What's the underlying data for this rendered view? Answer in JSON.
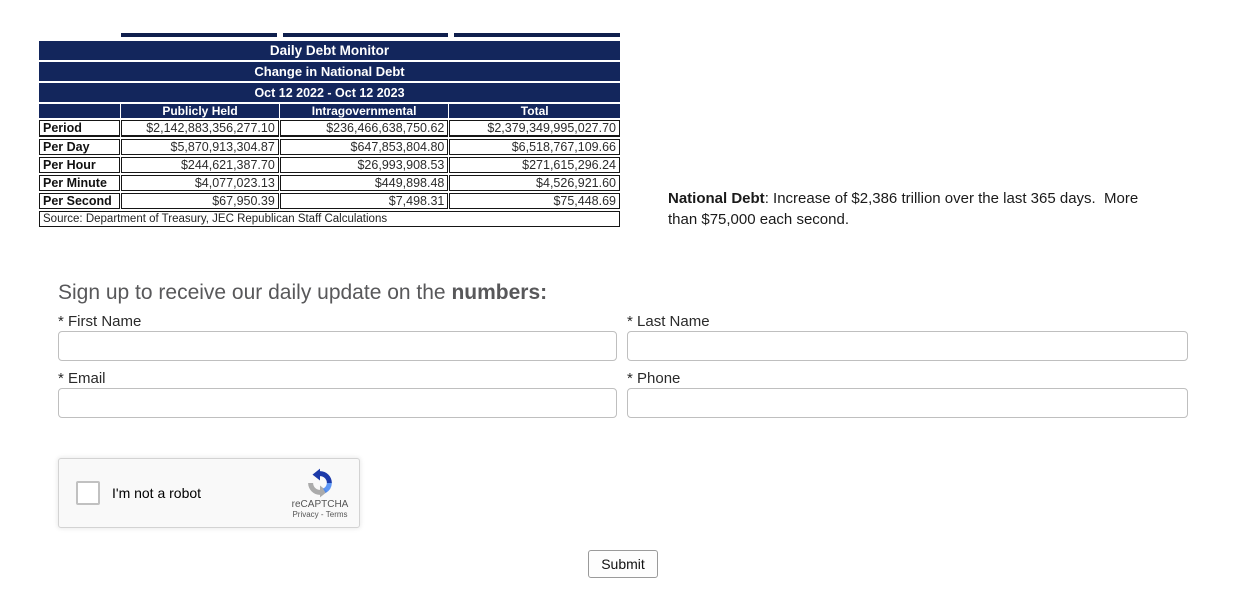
{
  "debt_table": {
    "title": "Daily Debt Monitor",
    "subtitle": "Change in National Debt",
    "date_range": "Oct 12 2022 - Oct 12 2023",
    "columns": [
      "",
      "Publicly Held",
      "Intragovernmental",
      "Total"
    ],
    "rows": [
      {
        "label": "Period",
        "values": [
          "$2,142,883,356,277.10",
          "$236,466,638,750.62",
          "$2,379,349,995,027.70"
        ]
      },
      {
        "label": "Per Day",
        "values": [
          "$5,870,913,304.87",
          "$647,853,804.80",
          "$6,518,767,109.66"
        ]
      },
      {
        "label": "Per Hour",
        "values": [
          "$244,621,387.70",
          "$26,993,908.53",
          "$271,615,296.24"
        ]
      },
      {
        "label": "Per Minute",
        "values": [
          "$4,077,023.13",
          "$449,898.48",
          "$4,526,921.60"
        ]
      },
      {
        "label": "Per Second",
        "values": [
          "$67,950.39",
          "$7,498.31",
          "$75,448.69"
        ]
      }
    ],
    "source": "Source: Department of Treasury, JEC Republican Staff Calculations"
  },
  "summary": {
    "label": "National Debt",
    "text": ": Increase of $2,386 trillion over the last 365 days.  More than $75,000 each second."
  },
  "signup": {
    "heading_normal": "Sign up to receive our daily update on the ",
    "heading_bold": "numbers:",
    "fields": [
      {
        "label": "* First Name"
      },
      {
        "label": "* Last Name"
      },
      {
        "label": "* Email"
      },
      {
        "label": "* Phone"
      }
    ]
  },
  "recaptcha": {
    "checkbox_label": "I'm not a robot",
    "brand": "reCAPTCHA",
    "privacy": "Privacy",
    "separator": " - ",
    "terms": "Terms"
  },
  "submit_label": "Submit",
  "colors": {
    "table_navy": "#13265C",
    "heading_gray": "#58585A",
    "recaptcha_blue": "#1C3AA9",
    "recaptcha_gray": "#ABABAB",
    "input_border": "#BFBFBF"
  }
}
